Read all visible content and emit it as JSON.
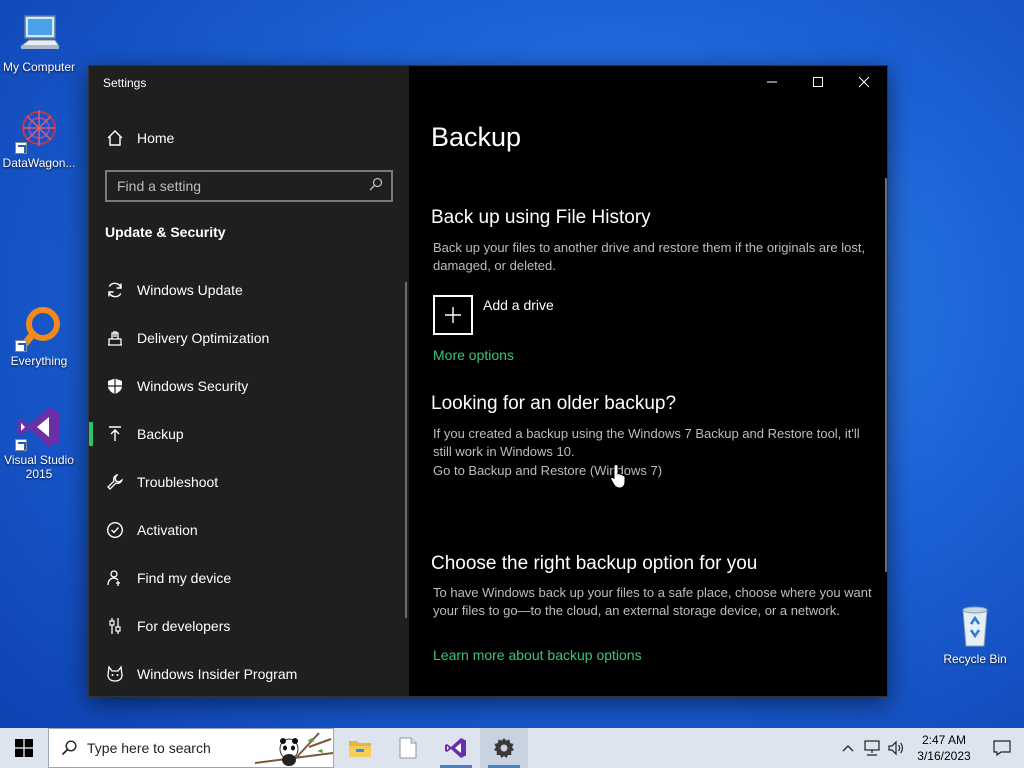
{
  "desktop": {
    "icons": [
      {
        "label": "My Computer",
        "icon": "computer-icon"
      },
      {
        "label": "DataWagon...",
        "icon": "datawagon-icon"
      },
      {
        "label": "Everything",
        "icon": "everything-search-icon"
      },
      {
        "label": "Visual Studio 2015",
        "icon": "visual-studio-icon"
      },
      {
        "label": "Recycle Bin",
        "icon": "recycle-bin-icon"
      }
    ]
  },
  "window": {
    "title": "Settings",
    "controls": {
      "minimize": "minimize-icon",
      "maximize": "maximize-icon",
      "close": "close-icon"
    }
  },
  "sidebar": {
    "home_label": "Home",
    "search_placeholder": "Find a setting",
    "section_heading": "Update & Security",
    "items": [
      {
        "label": "Windows Update",
        "icon": "sync-icon"
      },
      {
        "label": "Delivery Optimization",
        "icon": "delivery-optimization-icon"
      },
      {
        "label": "Windows Security",
        "icon": "shield-icon"
      },
      {
        "label": "Backup",
        "icon": "backup-arrow-icon",
        "active": true
      },
      {
        "label": "Troubleshoot",
        "icon": "wrench-icon"
      },
      {
        "label": "Activation",
        "icon": "checkmark-circle-icon"
      },
      {
        "label": "Find my device",
        "icon": "person-location-icon"
      },
      {
        "label": "For developers",
        "icon": "developer-sliders-icon"
      },
      {
        "label": "Windows Insider Program",
        "icon": "insider-cat-icon"
      }
    ]
  },
  "content": {
    "page_title": "Backup",
    "file_history": {
      "heading": "Back up using File History",
      "description": "Back up your files to another drive and restore them if the originals are lost, damaged, or deleted.",
      "add_drive_label": "Add a drive",
      "more_options_link": "More options"
    },
    "older_backup": {
      "heading": "Looking for an older backup?",
      "description": "If you created a backup using the Windows 7 Backup and Restore tool, it'll still work in Windows 10.",
      "restore_link": "Go to Backup and Restore (Windows 7)"
    },
    "right_option": {
      "heading": "Choose the right backup option for you",
      "description": "To have Windows back up your files to a safe place, choose where you want your files to go—to the cloud, an external storage device, or a network.",
      "learn_more_link": "Learn more about backup options"
    }
  },
  "taskbar": {
    "search_placeholder": "Type here to search",
    "apps": [
      {
        "name": "file-explorer-icon"
      },
      {
        "name": "notepad-icon"
      },
      {
        "name": "visual-studio-icon"
      },
      {
        "name": "settings-gear-icon",
        "active": true
      }
    ],
    "clock": {
      "time": "2:47 AM",
      "date": "3/16/2023"
    }
  },
  "colors": {
    "accent_green": "#3ec27b",
    "sidebar_bg": "#1f1f1f",
    "content_bg": "#000000",
    "taskbar_bg": "#dde4ee"
  }
}
